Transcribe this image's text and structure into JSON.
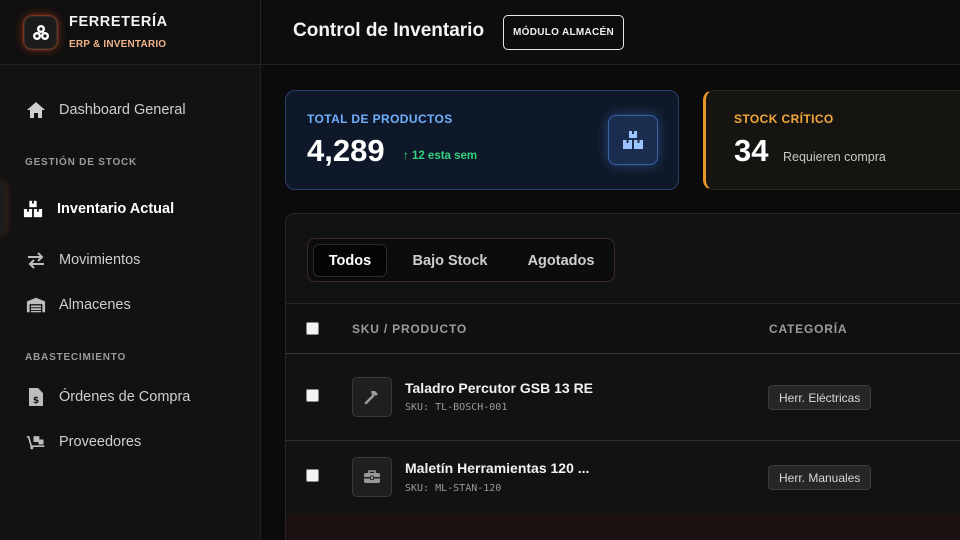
{
  "brand": {
    "title": "FERRETERÍA",
    "subtitle": "ERP & INVENTARIO",
    "logo_icon": "cubes-icon"
  },
  "sidebar": {
    "dashboard": {
      "label": "Dashboard General",
      "icon": "home-icon"
    },
    "section_stock": "GESTIÓN DE STOCK",
    "inventory": {
      "label": "Inventario Actual",
      "icon": "boxes-icon",
      "active": true
    },
    "movements": {
      "label": "Movimientos",
      "icon": "arrows-exchange-icon"
    },
    "warehouses": {
      "label": "Almacenes",
      "icon": "warehouse-icon"
    },
    "section_supply": "ABASTECIMIENTO",
    "purchase_orders": {
      "label": "Órdenes de Compra",
      "icon": "invoice-dollar-icon"
    },
    "suppliers": {
      "label": "Proveedores",
      "icon": "truck-loading-icon"
    }
  },
  "header": {
    "title": "Control de Inventario",
    "badge": "MÓDULO ALMACÉN"
  },
  "stats": {
    "products": {
      "label": "TOTAL DE PRODUCTOS",
      "value": "4,289",
      "trend": "↑ 12 esta sem",
      "icon": "boxes-icon"
    },
    "critical": {
      "label": "STOCK CRÍTICO",
      "value": "34",
      "note": "Requieren compra"
    }
  },
  "tabs": [
    {
      "label": "Todos",
      "active": true
    },
    {
      "label": "Bajo Stock"
    },
    {
      "label": "Agotados"
    }
  ],
  "table": {
    "columns": [
      "SKU / PRODUCTO",
      "CATEGORÍA"
    ],
    "rows": [
      {
        "name": "Taladro Percutor GSB 13 RE",
        "sku": "SKU: TL-BOSCH-001",
        "category": "Herr. Eléctricas",
        "icon": "hammer-icon"
      },
      {
        "name": "Maletín Herramientas 120 ...",
        "sku": "SKU: ML-STAN-120",
        "category": "Herr. Manuales",
        "icon": "toolbox-icon"
      }
    ]
  },
  "colors": {
    "accent_orange": "#e8952a",
    "accent_blue": "#6fb0ff",
    "trend_green": "#35d07f"
  }
}
